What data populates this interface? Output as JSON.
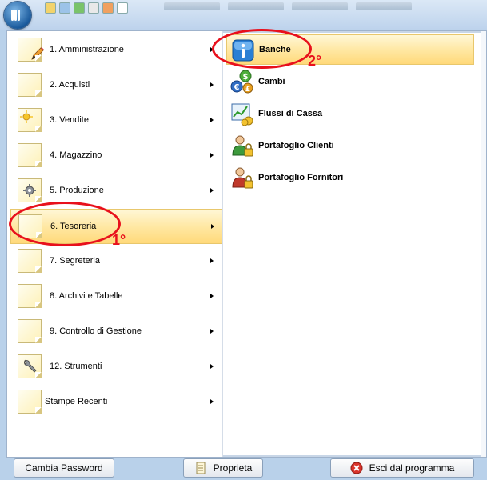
{
  "main_menu": {
    "items": [
      {
        "label": "1. Amministrazione",
        "icon": "pencil-icon"
      },
      {
        "label": "2. Acquisti",
        "icon": "note-icon"
      },
      {
        "label": "3. Vendite",
        "icon": "sun-note-icon"
      },
      {
        "label": "4. Magazzino",
        "icon": "note-icon"
      },
      {
        "label": "5. Produzione",
        "icon": "gear-icon"
      },
      {
        "label": "6. Tesoreria",
        "icon": "note-icon",
        "selected": true
      },
      {
        "label": "7. Segreteria",
        "icon": "note-icon"
      },
      {
        "label": "8. Archivi e Tabelle",
        "icon": "note-icon"
      },
      {
        "label": "9. Controllo di Gestione",
        "icon": "note-icon"
      },
      {
        "label": "12. Strumenti",
        "icon": "wrench-icon"
      },
      {
        "label": "Stampe Recenti",
        "icon": "note-icon"
      }
    ]
  },
  "submenu": {
    "items": [
      {
        "label": "Banche",
        "icon": "info-icon",
        "selected": true
      },
      {
        "label": "Cambi",
        "icon": "currency-icon"
      },
      {
        "label": "Flussi di Cassa",
        "icon": "chart-icon"
      },
      {
        "label": "Portafoglio Clienti",
        "icon": "person-lock-icon"
      },
      {
        "label": "Portafoglio Fornitori",
        "icon": "person-lock-icon"
      }
    ]
  },
  "footer": {
    "change_password": "Cambia Password",
    "properties": "Proprieta",
    "exit": "Esci dal programma"
  },
  "annotations": {
    "first": "1°",
    "second": "2°"
  },
  "colors": {
    "highlight": "#ffe8a4",
    "annotation": "#e8101c",
    "background": "#b9d1ea"
  }
}
